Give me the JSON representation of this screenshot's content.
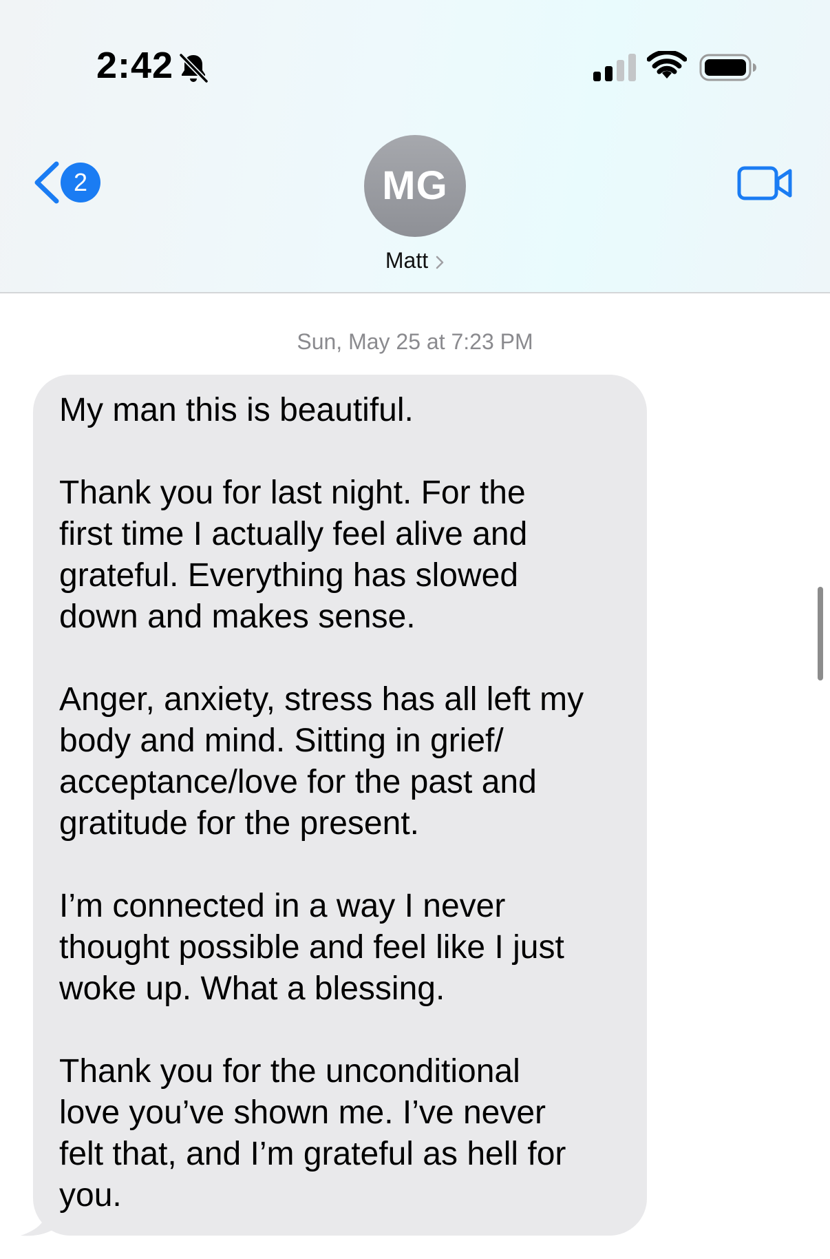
{
  "status_bar": {
    "time": "2:42",
    "icons": [
      "bell-slash-icon",
      "signal-icon",
      "wifi-icon",
      "battery-icon"
    ]
  },
  "nav": {
    "back_badge": "2",
    "avatar_initials": "MG",
    "contact_name": "Matt",
    "icons": [
      "chevron-left-icon",
      "chevron-right-icon",
      "video-camera-icon"
    ]
  },
  "conversation": {
    "timestamp": "Sun, May 25 at 7:23 PM",
    "message": {
      "direction": "incoming",
      "paragraphs": [
        "My man this is beautiful.",
        "Thank you for last night. For the\nfirst time I actually feel alive and\ngrateful. Everything has slowed\ndown and makes sense.",
        "Anger, anxiety, stress has all left my\nbody and mind. Sitting in grief/\nacceptance/love for the past and\ngratitude for the present.",
        "I’m connected in a way I never\nthought possible and feel like I just\nwoke up. What a blessing.",
        "Thank you for the unconditional\nlove you’ve shown me. I’ve never\nfelt that, and I’m grateful as hell for\nyou."
      ]
    }
  },
  "colors": {
    "accent": "#1a7cf3",
    "bubble_incoming": "#e9e9eb",
    "timestamp_text": "#8a8a8e",
    "avatar": "#9a9ca1"
  }
}
